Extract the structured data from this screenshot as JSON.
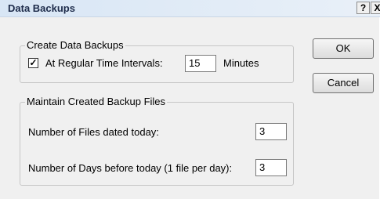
{
  "window": {
    "title": "Data Backups",
    "help_label": "?",
    "close_label": "X"
  },
  "create_group": {
    "legend": "Create Data Backups",
    "checkbox_checked": true,
    "checkbox_mark": "✓",
    "interval_label": "At Regular Time Intervals:",
    "interval_value": "15",
    "unit_label": "Minutes"
  },
  "maintain_group": {
    "legend": "Maintain Created Backup Files",
    "files_today_label": "Number of Files dated today:",
    "files_today_value": "3",
    "days_before_label": "Number of Days before today (1 file per day):",
    "days_before_value": "3"
  },
  "buttons": {
    "ok_label": "OK",
    "cancel_label": "Cancel"
  }
}
